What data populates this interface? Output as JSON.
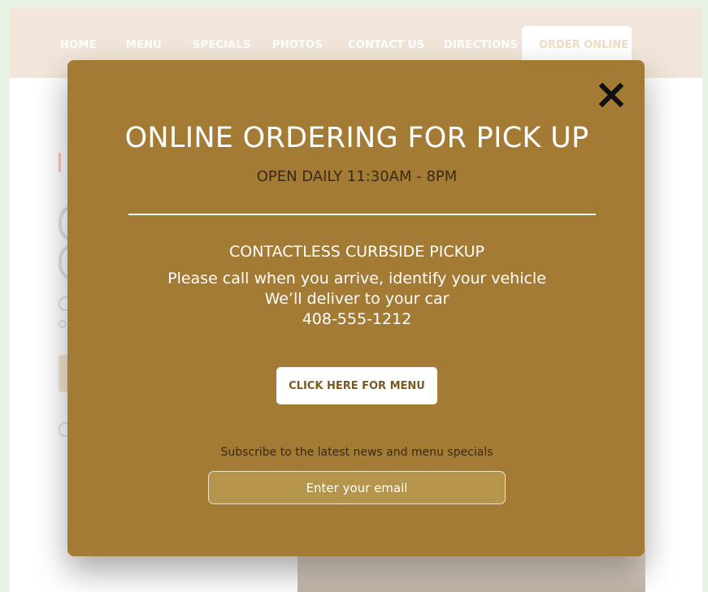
{
  "nav": {
    "items": [
      {
        "label": "HOME"
      },
      {
        "label": "MENU"
      },
      {
        "label": "SPECIALS"
      },
      {
        "label": "PHOTOS"
      },
      {
        "label": "CONTACT US"
      },
      {
        "label": "DIRECTIONS"
      }
    ],
    "order_online": "ORDER ONLINE"
  },
  "modal": {
    "close_icon": "close-icon",
    "title": "ONLINE ORDERING FOR PICK UP",
    "hours": "OPEN DAILY 11:30AM - 8PM",
    "pickup_heading": "CONTACTLESS CURBSIDE PICKUP",
    "pickup_line1": "Please call when you arrive, identify your vehicle",
    "pickup_line2": "We’ll deliver to your car",
    "phone": "408-555-1212",
    "menu_button": "CLICK HERE FOR MENU",
    "subscribe_text": "Subscribe to the latest news and menu specials",
    "email_placeholder": "Enter your email"
  },
  "colors": {
    "modal_bg": "#a47b34",
    "nav_bg": "#f1e6d9",
    "page_bg": "#e9f3e5",
    "input_bg": "#b4954b"
  }
}
